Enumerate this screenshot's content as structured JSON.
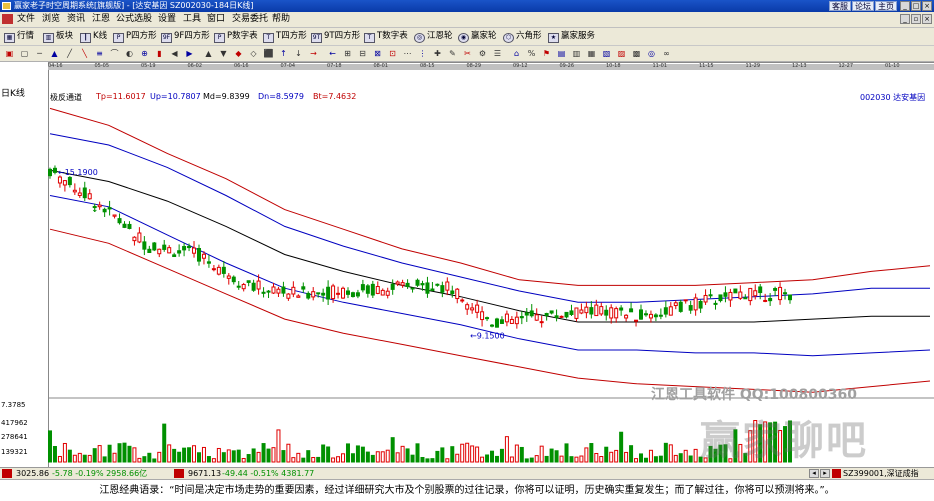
{
  "window": {
    "title": "赢家老子时空周期系统[旗舰版] - [达安基因  SZ002030-184日K线]",
    "buttons": [
      "客服",
      "论坛",
      "主页"
    ]
  },
  "menu": [
    "文件",
    "浏览",
    "资讯",
    "江恩",
    "公式选股",
    "设置",
    "工具",
    "窗口",
    "交易委托",
    "帮助"
  ],
  "toolbar": {
    "items": [
      {
        "label": "行情",
        "icon": "grid-icon"
      },
      {
        "label": "板块",
        "icon": "blocks-icon"
      },
      {
        "label": "K线",
        "icon": "candle-icon"
      },
      {
        "label": "P四方形",
        "icon": "square-p-icon"
      },
      {
        "label": "9F四方形",
        "icon": "square-9f-icon"
      },
      {
        "label": "P数字表",
        "icon": "table-p-icon"
      },
      {
        "label": "T四方形",
        "icon": "square-t-icon"
      },
      {
        "label": "9T四方形",
        "icon": "square-9t-icon"
      },
      {
        "label": "T数字表",
        "icon": "table-t-icon"
      },
      {
        "label": "江恩轮",
        "icon": "wheel-icon"
      },
      {
        "label": "赢家轮",
        "icon": "wheel2-icon"
      },
      {
        "label": "六角形",
        "icon": "hexagon-icon"
      },
      {
        "label": "赢家服务",
        "icon": "service-icon"
      }
    ]
  },
  "chart": {
    "period": "日K线",
    "indicator": "极反通道",
    "tp": "Tp=11.6017",
    "up": "Up=10.7807",
    "md": "Md=9.8399",
    "dn": "Dn=8.5979",
    "bt": "Bt=7.4632",
    "stock": "002030  达安基因",
    "high_label": "15.1900",
    "low_label": "9.1500",
    "volume_labels": [
      "7.3785",
      "417962",
      "278641",
      "139321"
    ],
    "date_labels": [
      "04-16",
      "05-05",
      "05-19",
      "06-02",
      "06-16",
      "07-04",
      "07-18",
      "08-01",
      "08-15",
      "08-29",
      "09-12",
      "09-26",
      "10-18",
      "11-01",
      "11-15",
      "11-29",
      "12-13",
      "12-27",
      "01-10"
    ],
    "colors": {
      "up": "#e00000",
      "down": "#009000",
      "channel_outer": "#c00000",
      "channel_inner": "#0000c0",
      "mid": "#000000"
    }
  },
  "chart_data": {
    "type": "candlestick",
    "title": "达安基因 SZ002030 日K线",
    "x": [
      "04-16",
      "05-05",
      "05-19",
      "06-02",
      "06-16",
      "07-04",
      "07-18",
      "08-01",
      "08-15",
      "08-29",
      "09-12",
      "09-26",
      "10-18",
      "11-01",
      "11-15",
      "11-29"
    ],
    "close": [
      15.0,
      13.8,
      12.3,
      12.0,
      10.9,
      10.6,
      10.7,
      10.8,
      10.9,
      9.6,
      9.8,
      10.0,
      9.8,
      10.2,
      10.6,
      10.6
    ],
    "high": 15.19,
    "low": 9.15,
    "series": [
      {
        "name": "Tp",
        "values": [
          17.2,
          16.6,
          15.6,
          14.7,
          13.6,
          12.9,
          12.2,
          11.7,
          11.1,
          10.9,
          10.9,
          10.9,
          11.0,
          11.1,
          11.4,
          11.6
        ]
      },
      {
        "name": "Up",
        "values": [
          16.3,
          15.9,
          15.1,
          14.1,
          13.0,
          12.3,
          11.7,
          11.2,
          10.7,
          10.3,
          10.3,
          10.4,
          10.5,
          10.6,
          10.8,
          10.8
        ]
      },
      {
        "name": "Md",
        "values": [
          15.0,
          14.6,
          13.9,
          13.0,
          12.0,
          11.4,
          10.9,
          10.5,
          10.0,
          9.6,
          9.6,
          9.6,
          9.6,
          9.7,
          9.8,
          9.8
        ]
      },
      {
        "name": "Dn",
        "values": [
          14.1,
          13.7,
          12.7,
          11.7,
          10.8,
          10.3,
          9.9,
          9.5,
          9.0,
          8.6,
          8.6,
          8.5,
          8.5,
          8.4,
          8.5,
          8.6
        ]
      },
      {
        "name": "Bt",
        "values": [
          12.9,
          12.4,
          11.5,
          10.6,
          9.7,
          9.2,
          8.8,
          8.4,
          8.0,
          7.6,
          7.4,
          7.3,
          7.2,
          7.1,
          7.3,
          7.5
        ]
      }
    ],
    "volume_max": 417962
  },
  "status": {
    "sh": "3025.86",
    "sh_change": "-5.78 -0.19% 2958.66亿",
    "sz": "9671.13",
    "sz_change": "-49.44 -0.51% 4381.77",
    "code": "SZ399001,深证成指"
  },
  "watermark": {
    "line1": "江恩工具软件  QQ:100800360",
    "line2": "赢家聊吧"
  },
  "quote": "江恩经典语录：“时间是决定市场走势的重要因素，经过详细研究大市及个别股票的过往记录，你将可以证明，历史确实重复发生；而了解过往，你将可以预测将来。”。"
}
